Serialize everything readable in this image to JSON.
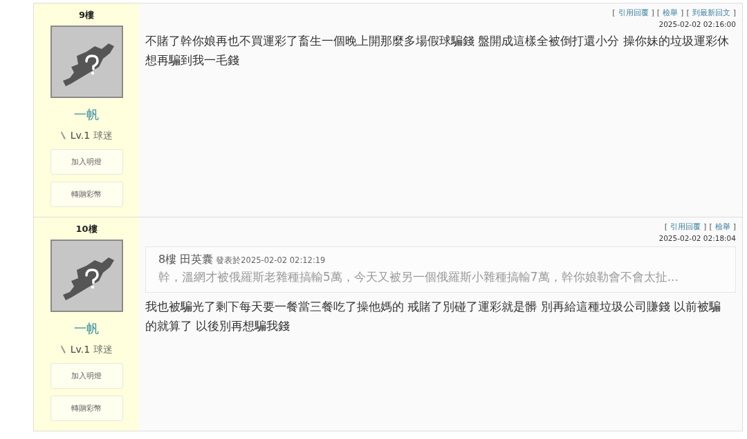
{
  "posts": [
    {
      "floor": "9樓",
      "user": {
        "name": "一帆",
        "level": "Lv.1",
        "rank": "球迷"
      },
      "buttons": [
        "加入明燈",
        "轉贈彩幣"
      ],
      "actions": [
        {
          "open": "[",
          "label": "引用回覆",
          "close": "]"
        },
        {
          "open": "[",
          "label": "檢舉",
          "close": "]"
        },
        {
          "open": "[",
          "label": "到最新回文",
          "close": "]"
        }
      ],
      "time": "2025-02-02 02:16:00",
      "body": "不賭了幹你娘再也不買運彩了畜生一個晚上開那麼多場假球騙錢 盤開成這樣全被倒打還小分 操你妹的垃圾運彩休想再騙到我一毛錢"
    },
    {
      "floor": "10樓",
      "user": {
        "name": "一帆",
        "level": "Lv.1",
        "rank": "球迷"
      },
      "buttons": [
        "加入明燈",
        "轉贈彩幣"
      ],
      "actions": [
        {
          "open": "[",
          "label": "引用回覆",
          "close": "]"
        },
        {
          "open": "[",
          "label": "檢舉",
          "close": "]"
        }
      ],
      "time": "2025-02-02 02:18:04",
      "quote": {
        "author": "8樓 田英囊",
        "posted": "發表於2025-02-02 02:12:19",
        "text": "幹，溫網才被俄羅斯老雜種搞輸5萬，今天又被另一個俄羅斯小雜種搞輸7萬，幹你娘勒會不會太扯..."
      },
      "body": "我也被騙光了剩下每天要一餐當三餐吃了操他媽的 戒賭了別碰了運彩就是髒 別再給這種垃圾公司賺錢 以前被騙的就算了 以後別再想騙我錢"
    }
  ]
}
